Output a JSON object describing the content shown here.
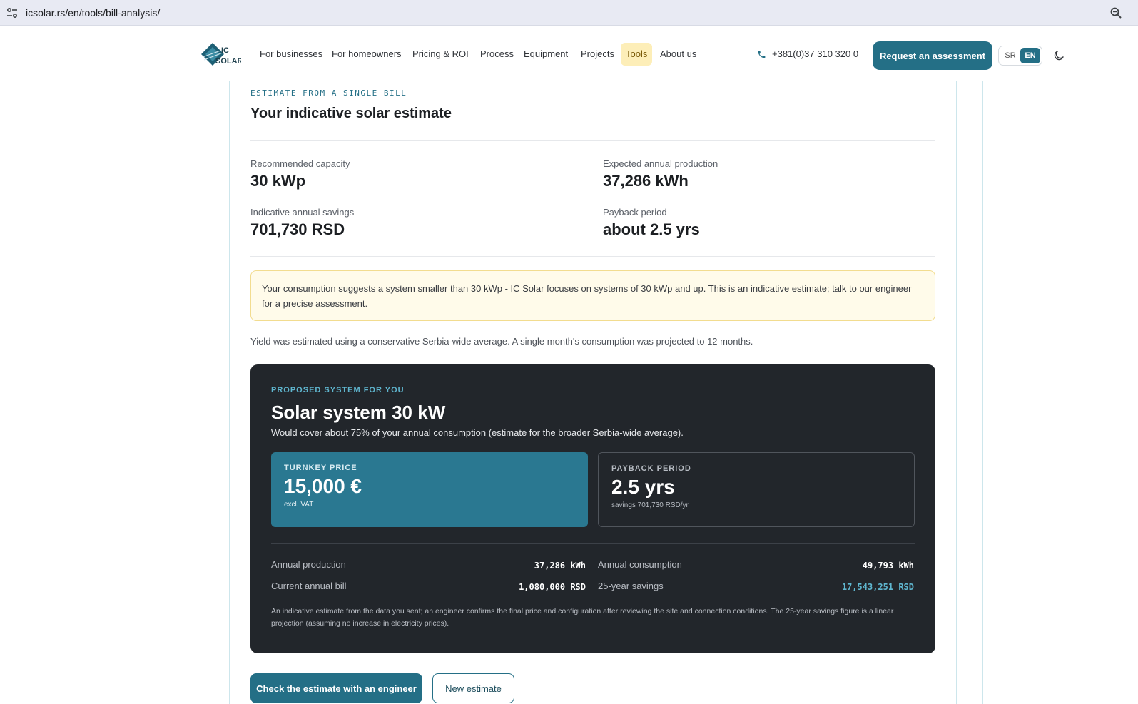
{
  "browser": {
    "url": "icsolar.rs/en/tools/bill-analysis/"
  },
  "nav": {
    "logo_text": "IC SOLAR",
    "links": [
      "For businesses",
      "For homeowners",
      "Pricing & ROI",
      "Process",
      "Equipment",
      "Projects",
      "Tools",
      "About us"
    ],
    "active": "Tools",
    "phone": "+381(0)37 310 320 0",
    "cta": "Request an assessment",
    "lang_sr": "SR",
    "lang_en": "EN",
    "lang_active": "EN"
  },
  "estimate": {
    "eyebrow": "ESTIMATE FROM A SINGLE BILL",
    "title": "Your indicative solar estimate",
    "capacity_label": "Recommended capacity",
    "capacity_value": "30 kWp",
    "production_label": "Expected annual production",
    "production_value": "37,286 kWh",
    "savings_label": "Indicative annual savings",
    "savings_value": "701,730 RSD",
    "payback_label": "Payback period",
    "payback_value": "about 2.5 yrs",
    "notice": "Your consumption suggests a system smaller than 30 kWp - IC Solar focuses on systems of 30 kWp and up. This is an indicative estimate; talk to our engineer for a precise assessment.",
    "yield_note": "Yield was estimated using a conservative Serbia-wide average. A single month's consumption was projected to 12 months."
  },
  "proposal": {
    "eyebrow": "PROPOSED SYSTEM FOR YOU",
    "title": "Solar system 30 kW",
    "subtitle": "Would cover about 75% of your annual consumption (estimate for the broader Serbia-wide average).",
    "price_label": "TURNKEY PRICE",
    "price_value": "15,000 €",
    "price_note": "excl. VAT",
    "payback_label": "PAYBACK PERIOD",
    "payback_value": "2.5 yrs",
    "payback_note": "savings 701,730 RSD/yr",
    "annual_production_label": "Annual production",
    "annual_production_value": "37,286 kWh",
    "annual_consumption_label": "Annual consumption",
    "annual_consumption_value": "49,793 kWh",
    "current_bill_label": "Current annual bill",
    "current_bill_value": "1,080,000 RSD",
    "savings25_label": "25-year savings",
    "savings25_value": "17,543,251 RSD",
    "footnote": "An indicative estimate from the data you sent; an engineer confirms the final price and configuration after reviewing the site and connection conditions. The 25-year savings figure is a linear projection (assuming no increase in electricity prices).",
    "accent_color": "#5fb6cf"
  },
  "actions": {
    "primary": "Check the estimate with an engineer",
    "secondary": "New estimate"
  },
  "colors": {
    "brand": "#246f86",
    "dark_panel": "#22262b",
    "notice_bg": "#fffbea",
    "active_nav_bg": "#fdeeb8"
  }
}
